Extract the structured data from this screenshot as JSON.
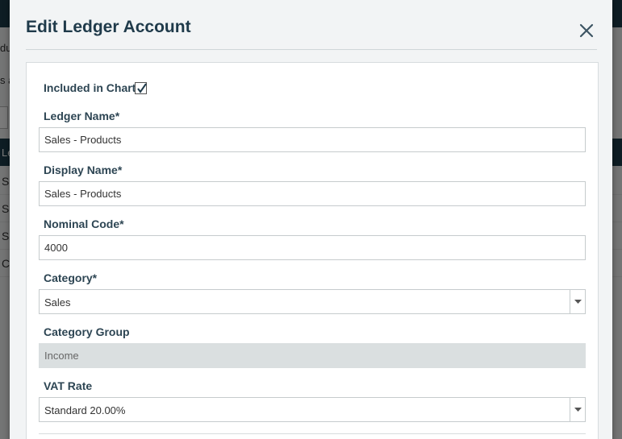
{
  "background": {
    "fragment_1": "du",
    "fragment_2": "s a",
    "table_header": "Le",
    "rows": [
      "Sa",
      "Sa",
      "Sa",
      "C"
    ]
  },
  "modal": {
    "title": "Edit Ledger Account",
    "close_icon": "close-icon"
  },
  "form": {
    "included_in_chart": {
      "label": "Included in Chart",
      "checked": true
    },
    "ledger_name": {
      "label": "Ledger Name*",
      "value": "Sales - Products"
    },
    "display_name": {
      "label": "Display Name*",
      "value": "Sales - Products"
    },
    "nominal_code": {
      "label": "Nominal Code*",
      "value": "4000"
    },
    "category": {
      "label": "Category*",
      "selected": "Sales"
    },
    "category_group": {
      "label": "Category Group",
      "value": "Income",
      "disabled": true
    },
    "vat_rate": {
      "label": "VAT Rate",
      "selected": "Standard 20.00%"
    }
  },
  "colors": {
    "header_bar": "#1f3e4c",
    "title_text": "#1f3a4a",
    "label_text": "#2d4553",
    "disabled_field": "#dadfe0"
  }
}
